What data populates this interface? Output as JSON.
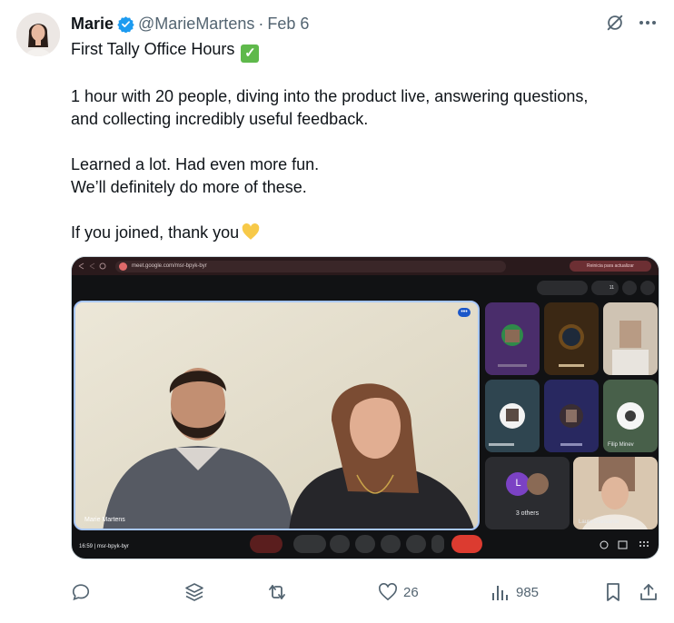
{
  "post": {
    "author_name": "Marie",
    "handle": "@MarieMartens",
    "separator": "·",
    "date": "Feb 6",
    "text_lines": [
      "First Tally Office Hours",
      "1 hour with 20 people, diving into the product live, answering questions,",
      "and collecting incredibly useful feedback.",
      "Learned a lot. Had even more fun.",
      "We’ll definitely do more of these.",
      "If you joined, thank you"
    ],
    "emoji_check": "✓"
  },
  "media": {
    "url": "meet.google.com/msr-bpyk-byr",
    "browser_button": "Reinicia para actualizar",
    "main_speaker": "Marie Martens",
    "self_view_name": "Laura Giansante",
    "tile_name": "Filip Minev",
    "others_count": "3 others",
    "others_initial": "L",
    "meeting_info": "16:59  |  msr-bpyk-byr",
    "participant_count": "11"
  },
  "actions": {
    "reply_count": "",
    "like_count": "26",
    "views_count": "985"
  },
  "colors": {
    "text": "#0f1419",
    "muted": "#536471",
    "verified": "#1d9bf0",
    "heart_emoji": "#f7c948",
    "check_emoji": "#5fb94b"
  }
}
